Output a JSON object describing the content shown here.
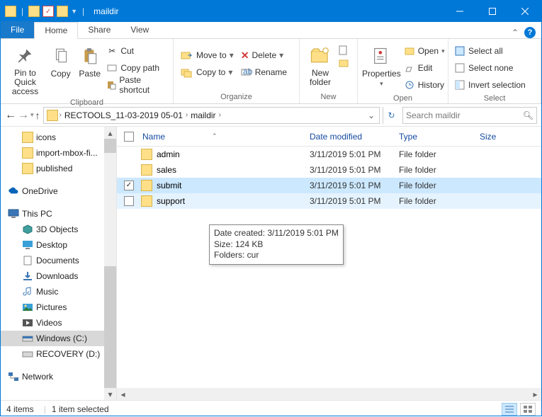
{
  "window": {
    "title": "maildir",
    "qa_items": [
      "folder-icon",
      "folder-icon",
      "check-icon",
      "folder-icon"
    ]
  },
  "tabs": {
    "file": "File",
    "home": "Home",
    "share": "Share",
    "view": "View"
  },
  "ribbon": {
    "clipboard": {
      "label": "Clipboard",
      "pin": "Pin to Quick access",
      "copy": "Copy",
      "paste": "Paste",
      "cut": "Cut",
      "copy_path": "Copy path",
      "paste_shortcut": "Paste shortcut"
    },
    "organize": {
      "label": "Organize",
      "move_to": "Move to",
      "copy_to": "Copy to",
      "delete": "Delete",
      "rename": "Rename"
    },
    "new": {
      "label": "New",
      "new_folder": "New folder"
    },
    "open": {
      "label": "Open",
      "properties": "Properties",
      "open": "Open",
      "edit": "Edit",
      "history": "History"
    },
    "select": {
      "label": "Select",
      "select_all": "Select all",
      "select_none": "Select none",
      "invert": "Invert selection"
    }
  },
  "breadcrumb": {
    "parts": [
      "RECTOOLS_11-03-2019 05-01",
      "maildir"
    ]
  },
  "search": {
    "placeholder": "Search maildir"
  },
  "tree": {
    "quick": [
      {
        "label": "icons"
      },
      {
        "label": "import-mbox-fi..."
      },
      {
        "label": "published"
      }
    ],
    "onedrive": "OneDrive",
    "thispc": "This PC",
    "pc_items": [
      "3D Objects",
      "Desktop",
      "Documents",
      "Downloads",
      "Music",
      "Pictures",
      "Videos",
      "Windows (C:)",
      "RECOVERY (D:)"
    ],
    "network": "Network"
  },
  "columns": {
    "name": "Name",
    "date": "Date modified",
    "type": "Type",
    "size": "Size"
  },
  "rows": [
    {
      "name": "admin",
      "date": "3/11/2019 5:01 PM",
      "type": "File folder",
      "checked": false,
      "sel": false
    },
    {
      "name": "sales",
      "date": "3/11/2019 5:01 PM",
      "type": "File folder",
      "checked": false,
      "sel": false
    },
    {
      "name": "submit",
      "date": "3/11/2019 5:01 PM",
      "type": "File folder",
      "checked": true,
      "sel": true
    },
    {
      "name": "support",
      "date": "3/11/2019 5:01 PM",
      "type": "File folder",
      "checked": false,
      "sel": false
    }
  ],
  "tooltip": {
    "line1": "Date created: 3/11/2019 5:01 PM",
    "line2": "Size: 124 KB",
    "line3": "Folders: cur"
  },
  "status": {
    "count": "4 items",
    "selected": "1 item selected"
  }
}
